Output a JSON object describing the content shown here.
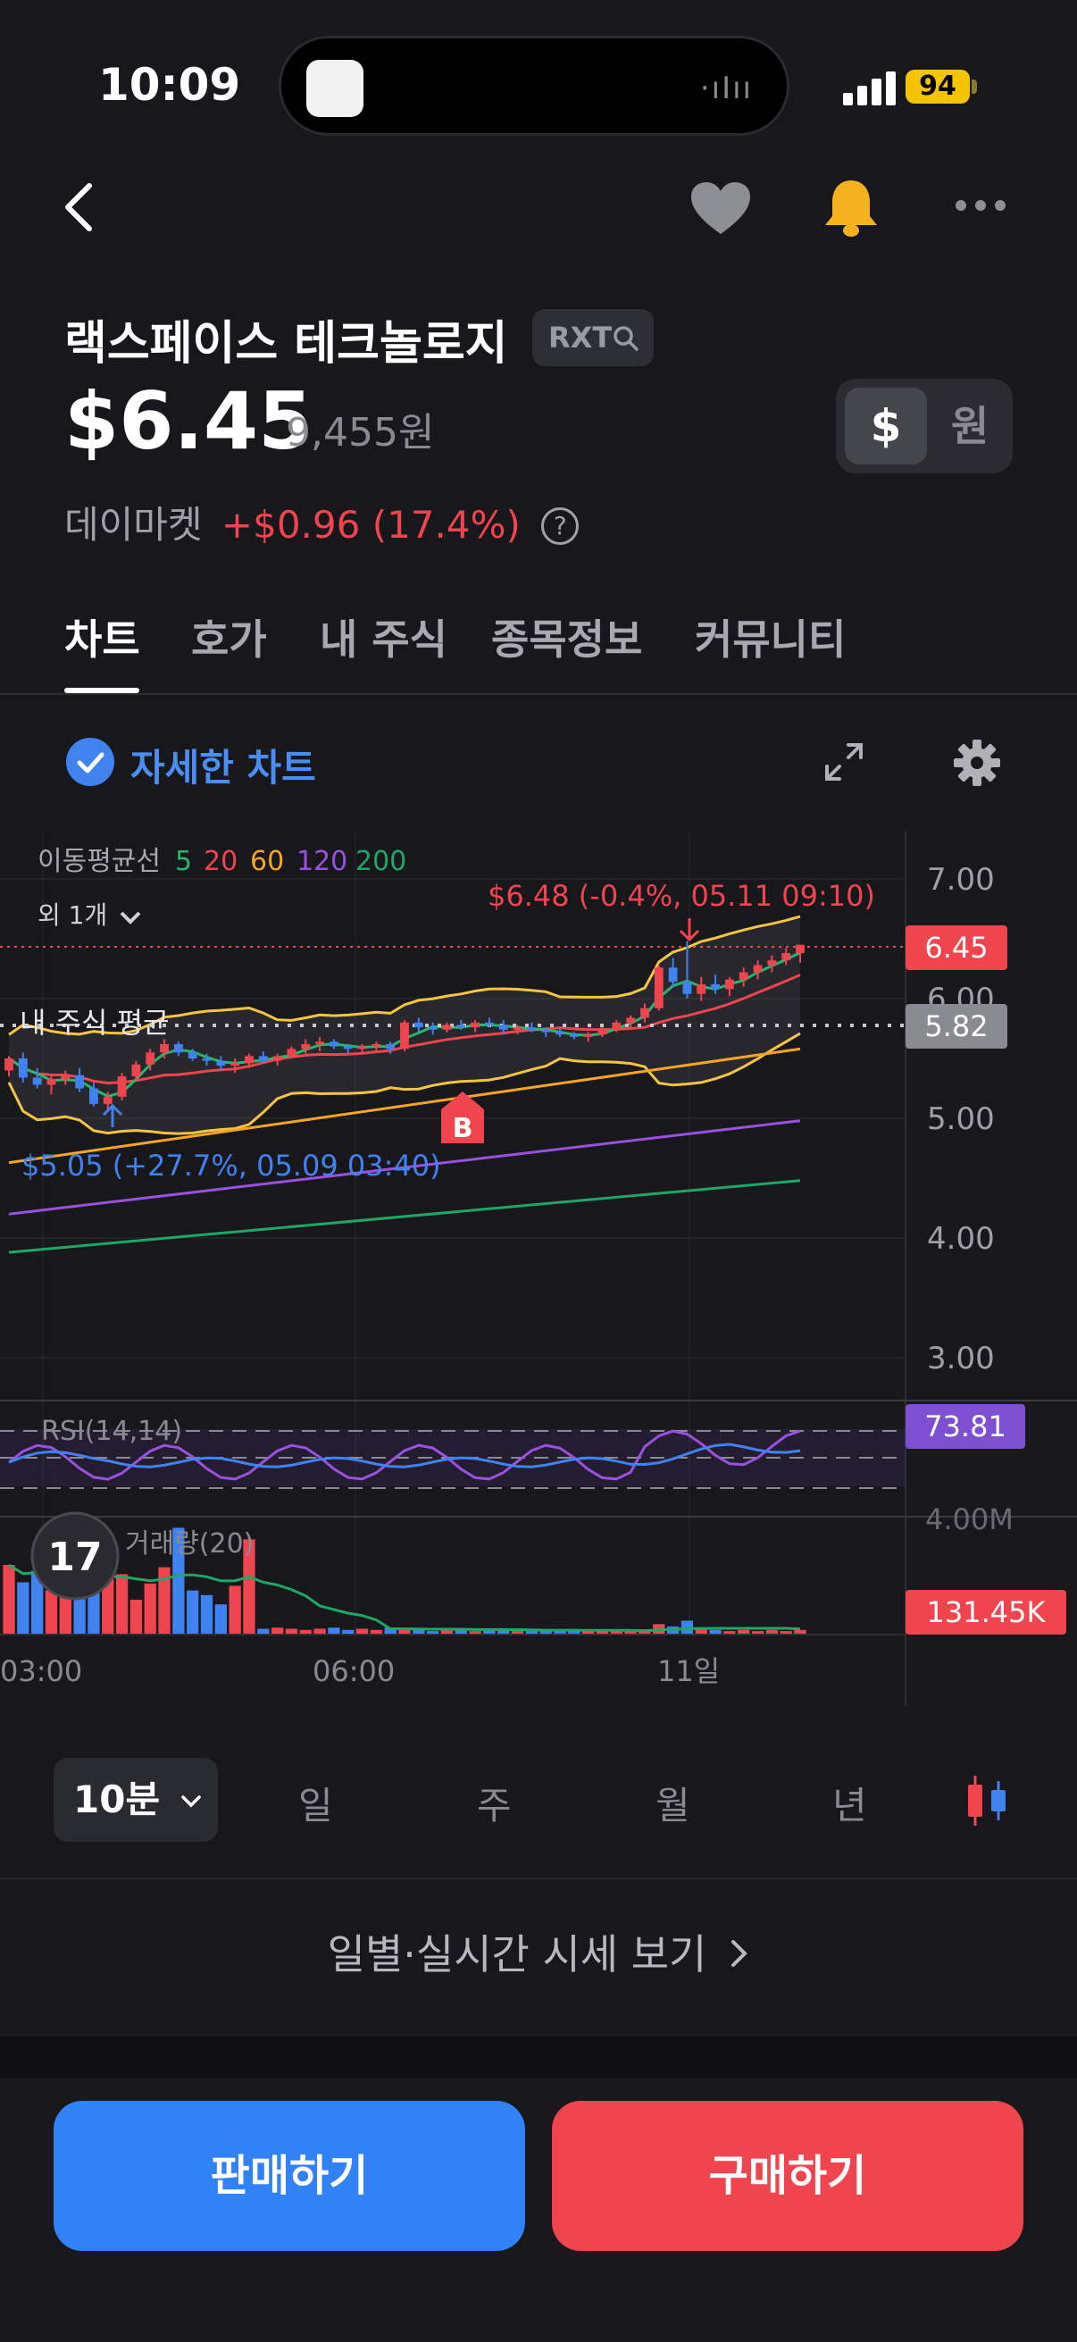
{
  "status_bar": {
    "time": "10:09",
    "battery": "94"
  },
  "stock": {
    "name": "랙스페이스 테크놀로지",
    "ticker": "RXT",
    "price": "$6.45",
    "price_krw": "9,455원",
    "market_label": "데이마켓",
    "change": "+$0.96 (17.4%)",
    "help": "?"
  },
  "currency_toggle": {
    "usd": "$",
    "krw": "원"
  },
  "tabs": [
    {
      "label": "차트",
      "active": true
    },
    {
      "label": "호가"
    },
    {
      "label": "내 주식"
    },
    {
      "label": "종목정보"
    },
    {
      "label": "커뮤니티"
    }
  ],
  "detail_chart_label": "자세한 차트",
  "chart_data": {
    "type": "candlestick",
    "legend": {
      "ma_title": "이동평균선",
      "ma_periods": [
        "5",
        "20",
        "60",
        "120",
        "200"
      ],
      "ma_colors": [
        "#27b76b",
        "#f0454f",
        "#f5a623",
        "#9b51e0",
        "#1fa865"
      ],
      "more": "외 1개"
    },
    "y_ticks": [
      "7.00",
      "6.00",
      "5.00",
      "4.00",
      "3.00"
    ],
    "y_range": [
      3.0,
      7.0
    ],
    "x_ticks": [
      "03:00",
      "06:00",
      "11일"
    ],
    "current_price_tag": "6.45",
    "avg_price_label": "내 주식 평균",
    "avg_price_tag": "5.82",
    "high_annotation": "$6.48 (-0.4%, 05.11 09:10)",
    "low_annotation": "$5.05 (+27.7%, 05.09 03:40)",
    "buy_marker": "B",
    "rsi": {
      "label": "RSI(14,14)",
      "value": "73.81"
    },
    "volume": {
      "label": "거래량(20)",
      "value": "131.45K",
      "axis_top": "4.00M"
    },
    "candles": [
      [
        5.4,
        5.52,
        5.35,
        5.5
      ],
      [
        5.5,
        5.55,
        5.3,
        5.34
      ],
      [
        5.34,
        5.42,
        5.25,
        5.28
      ],
      [
        5.28,
        5.36,
        5.2,
        5.33
      ],
      [
        5.33,
        5.4,
        5.28,
        5.36
      ],
      [
        5.36,
        5.42,
        5.22,
        5.25
      ],
      [
        5.25,
        5.3,
        5.1,
        5.12
      ],
      [
        5.12,
        5.22,
        5.06,
        5.18
      ],
      [
        5.18,
        5.38,
        5.15,
        5.35
      ],
      [
        5.35,
        5.48,
        5.32,
        5.45
      ],
      [
        5.45,
        5.58,
        5.4,
        5.55
      ],
      [
        5.55,
        5.66,
        5.5,
        5.62
      ],
      [
        5.62,
        5.64,
        5.52,
        5.55
      ],
      [
        5.55,
        5.58,
        5.48,
        5.5
      ],
      [
        5.5,
        5.54,
        5.44,
        5.48
      ],
      [
        5.48,
        5.52,
        5.4,
        5.44
      ],
      [
        5.44,
        5.5,
        5.38,
        5.46
      ],
      [
        5.46,
        5.54,
        5.42,
        5.52
      ],
      [
        5.52,
        5.56,
        5.46,
        5.48
      ],
      [
        5.48,
        5.54,
        5.44,
        5.52
      ],
      [
        5.52,
        5.6,
        5.5,
        5.58
      ],
      [
        5.58,
        5.66,
        5.54,
        5.62
      ],
      [
        5.62,
        5.68,
        5.56,
        5.64
      ],
      [
        5.64,
        5.66,
        5.58,
        5.6
      ],
      [
        5.6,
        5.62,
        5.54,
        5.58
      ],
      [
        5.58,
        5.62,
        5.55,
        5.6
      ],
      [
        5.6,
        5.64,
        5.56,
        5.62
      ],
      [
        5.62,
        5.64,
        5.54,
        5.58
      ],
      [
        5.58,
        5.82,
        5.56,
        5.8
      ],
      [
        5.8,
        5.84,
        5.72,
        5.76
      ],
      [
        5.76,
        5.8,
        5.7,
        5.74
      ],
      [
        5.74,
        5.8,
        5.72,
        5.78
      ],
      [
        5.78,
        5.82,
        5.74,
        5.76
      ],
      [
        5.76,
        5.82,
        5.72,
        5.8
      ],
      [
        5.8,
        5.84,
        5.76,
        5.78
      ],
      [
        5.78,
        5.82,
        5.7,
        5.74
      ],
      [
        5.74,
        5.78,
        5.7,
        5.76
      ],
      [
        5.76,
        5.8,
        5.72,
        5.74
      ],
      [
        5.74,
        5.76,
        5.68,
        5.72
      ],
      [
        5.72,
        5.76,
        5.68,
        5.7
      ],
      [
        5.7,
        5.72,
        5.66,
        5.68
      ],
      [
        5.68,
        5.72,
        5.64,
        5.7
      ],
      [
        5.7,
        5.76,
        5.68,
        5.74
      ],
      [
        5.74,
        5.82,
        5.72,
        5.8
      ],
      [
        5.8,
        5.86,
        5.76,
        5.84
      ],
      [
        5.84,
        5.96,
        5.8,
        5.92
      ],
      [
        5.92,
        6.28,
        5.9,
        6.26
      ],
      [
        6.26,
        6.34,
        6.1,
        6.14
      ],
      [
        6.14,
        6.48,
        6.0,
        6.04
      ],
      [
        6.04,
        6.18,
        5.98,
        6.12
      ],
      [
        6.12,
        6.2,
        6.04,
        6.08
      ],
      [
        6.08,
        6.18,
        6.02,
        6.16
      ],
      [
        6.16,
        6.26,
        6.1,
        6.22
      ],
      [
        6.22,
        6.32,
        6.16,
        6.28
      ],
      [
        6.28,
        6.36,
        6.22,
        6.32
      ],
      [
        6.32,
        6.42,
        6.28,
        6.38
      ],
      [
        6.38,
        6.45,
        6.3,
        6.45
      ]
    ],
    "volume_bars": [
      0.6,
      0.45,
      0.55,
      0.38,
      0.5,
      0.62,
      0.4,
      0.48,
      0.52,
      0.3,
      0.44,
      0.58,
      0.92,
      0.38,
      0.34,
      0.26,
      0.42,
      0.82,
      0.05,
      0.06,
      0.05,
      0.04,
      0.05,
      0.06,
      0.04,
      0.05,
      0.04,
      0.06,
      0.05,
      0.04,
      0.03,
      0.05,
      0.04,
      0.03,
      0.04,
      0.05,
      0.03,
      0.04,
      0.03,
      0.04,
      0.03,
      0.03,
      0.04,
      0.03,
      0.04,
      0.03,
      0.09,
      0.07,
      0.12,
      0.05,
      0.04,
      0.03,
      0.04,
      0.03,
      0.04,
      0.03,
      0.04
    ]
  },
  "period_selector": {
    "selected": "10분",
    "options": [
      "일",
      "주",
      "월",
      "년"
    ]
  },
  "view_quotes": "일별·실시간 시세 보기",
  "buttons": {
    "sell": "판매하기",
    "buy": "구매하기"
  }
}
